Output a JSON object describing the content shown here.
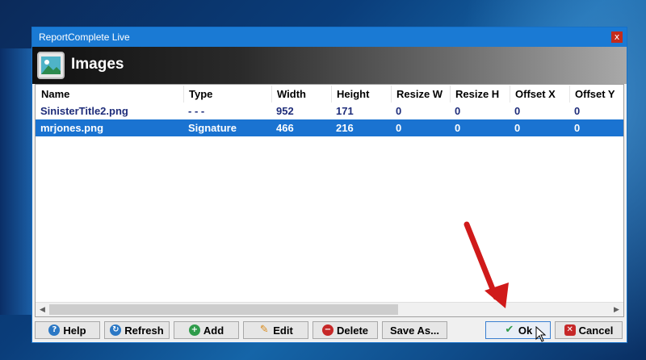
{
  "window": {
    "title": "ReportComplete Live",
    "close_glyph": "x"
  },
  "header": {
    "title": "Images",
    "icon": "image-icon"
  },
  "columns": [
    "Name",
    "Type",
    "Width",
    "Height",
    "Resize W",
    "Resize H",
    "Offset X",
    "Offset Y"
  ],
  "rows": [
    {
      "cells": [
        "SinisterTitle2.png",
        "- - -",
        "952",
        "171",
        "0",
        "0",
        "0",
        "0"
      ],
      "selected": false
    },
    {
      "cells": [
        "mrjones.png",
        "Signature",
        "466",
        "216",
        "0",
        "0",
        "0",
        "0"
      ],
      "selected": true
    }
  ],
  "scrollbar": {
    "left_glyph": "◀",
    "right_glyph": "▶"
  },
  "buttons": {
    "help": {
      "label": "Help",
      "icon": "help-icon",
      "glyph": "?",
      "color": "#2b78c5"
    },
    "refresh": {
      "label": "Refresh",
      "icon": "refresh-icon",
      "glyph": "↻",
      "color": "#2b78c5"
    },
    "add": {
      "label": "Add",
      "icon": "add-icon",
      "glyph": "+",
      "color": "#2e9b4a"
    },
    "edit": {
      "label": "Edit",
      "icon": "pencil-icon",
      "glyph": "✎",
      "color": "#d98a1a"
    },
    "delete": {
      "label": "Delete",
      "icon": "delete-icon",
      "glyph": "−",
      "color": "#c62828"
    },
    "save_as": {
      "label": "Save As..."
    },
    "ok": {
      "label": "Ok",
      "icon": "checkmark-icon",
      "glyph": "✔",
      "color": "#2e9b4a"
    },
    "cancel": {
      "label": "Cancel",
      "icon": "cancel-icon",
      "glyph": "✕",
      "color": "#c62828"
    }
  },
  "colors": {
    "selection": "#1a73d1",
    "row_text": "#1f2d7a",
    "annotation_arrow": "#d01a1a"
  }
}
